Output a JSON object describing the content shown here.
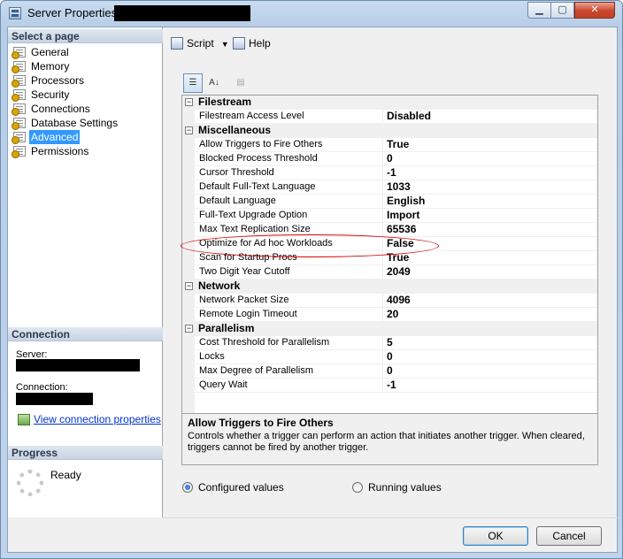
{
  "window": {
    "title": "Server Properties - "
  },
  "left": {
    "select_page_header": "Select a page",
    "pages": [
      {
        "label": "General"
      },
      {
        "label": "Memory"
      },
      {
        "label": "Processors"
      },
      {
        "label": "Security"
      },
      {
        "label": "Connections"
      },
      {
        "label": "Database Settings"
      },
      {
        "label": "Advanced",
        "selected": true
      },
      {
        "label": "Permissions"
      }
    ],
    "connection_header": "Connection",
    "server_label": "Server:",
    "connection_label": "Connection:",
    "view_connection_link": "View connection properties",
    "progress_header": "Progress",
    "progress_status": "Ready"
  },
  "toolbar": {
    "script_label": "Script",
    "help_label": "Help"
  },
  "grid_toolbar": {
    "categorized_icon": "categorized-icon",
    "alphabetical_icon": "az-sort-icon",
    "property_pages_icon": "property-pages-icon"
  },
  "grid": {
    "categories": [
      {
        "name": "Filestream",
        "props": [
          {
            "name": "Filestream Access Level",
            "value": "Disabled"
          }
        ]
      },
      {
        "name": "Miscellaneous",
        "props": [
          {
            "name": "Allow Triggers to Fire Others",
            "value": "True"
          },
          {
            "name": "Blocked Process Threshold",
            "value": "0"
          },
          {
            "name": "Cursor Threshold",
            "value": "-1"
          },
          {
            "name": "Default Full-Text Language",
            "value": "1033"
          },
          {
            "name": "Default Language",
            "value": "English"
          },
          {
            "name": "Full-Text Upgrade Option",
            "value": "Import"
          },
          {
            "name": "Max Text Replication Size",
            "value": "65536"
          },
          {
            "name": "Optimize for Ad hoc Workloads",
            "value": "False"
          },
          {
            "name": "Scan for Startup Procs",
            "value": "True"
          },
          {
            "name": "Two Digit Year Cutoff",
            "value": "2049"
          }
        ]
      },
      {
        "name": "Network",
        "props": [
          {
            "name": "Network Packet Size",
            "value": "4096"
          },
          {
            "name": "Remote Login Timeout",
            "value": "20"
          }
        ]
      },
      {
        "name": "Parallelism",
        "props": [
          {
            "name": "Cost Threshold for Parallelism",
            "value": "5"
          },
          {
            "name": "Locks",
            "value": "0"
          },
          {
            "name": "Max Degree of Parallelism",
            "value": "0"
          },
          {
            "name": "Query Wait",
            "value": "-1"
          }
        ]
      }
    ],
    "highlight_color": "#d40000"
  },
  "description": {
    "title": "Allow Triggers to Fire Others",
    "body": "Controls whether a trigger can perform an action that initiates another trigger. When cleared, triggers cannot be fired by another trigger."
  },
  "view_options": {
    "configured_label": "Configured values",
    "running_label": "Running values",
    "selected": "configured"
  },
  "buttons": {
    "ok_label": "OK",
    "cancel_label": "Cancel"
  }
}
